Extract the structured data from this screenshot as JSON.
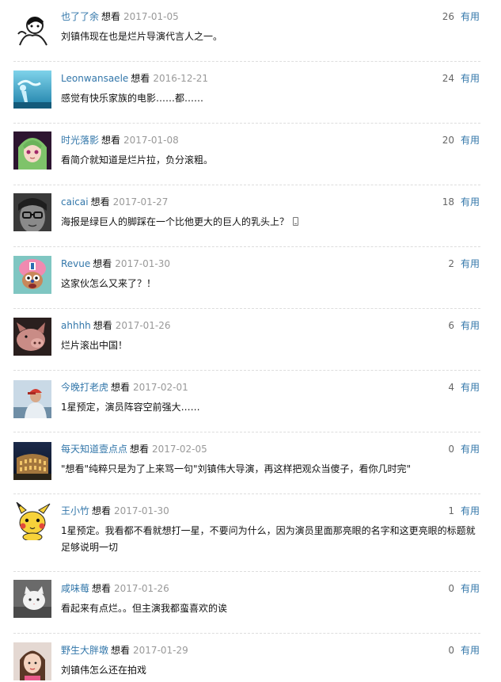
{
  "useful_label": "有用",
  "comments": [
    {
      "user": "也了了余",
      "status": "想看",
      "date": "2017-01-05",
      "votes": "26",
      "text": "刘镇伟现在也是烂片导演代言人之一。",
      "avatar": "bw-sketch-avatar"
    },
    {
      "user": "Leonwansaele",
      "status": "想看",
      "date": "2016-12-21",
      "votes": "24",
      "text": "感觉有快乐家族的电影……都……",
      "avatar": "underwater-blue-avatar"
    },
    {
      "user": "时光落影",
      "status": "想看",
      "date": "2017-01-08",
      "votes": "20",
      "text": "看简介就知道是烂片拉，负分滚粗。",
      "avatar": "anime-girl-avatar"
    },
    {
      "user": "caicai",
      "status": "想看",
      "date": "2017-01-27",
      "votes": "18",
      "text": "海报是绿巨人的脚踩在一个比他更大的巨人的乳头上？",
      "avatar": "glasses-face-avatar",
      "mobile_icon": "mobile-phone-icon"
    },
    {
      "user": "Revue",
      "status": "想看",
      "date": "2017-01-30",
      "votes": "2",
      "text": "这家伙怎么又来了？！",
      "avatar": "cartoon-chopper-avatar"
    },
    {
      "user": "ahhhh",
      "status": "想看",
      "date": "2017-01-26",
      "votes": "6",
      "text": "烂片滚出中国！",
      "avatar": "pig-avatar"
    },
    {
      "user": "今晚打老虎",
      "status": "想看",
      "date": "2017-02-01",
      "votes": "4",
      "text": "1星预定，演员阵容空前强大……",
      "avatar": "red-cap-person-avatar"
    },
    {
      "user": "每天知道壹点点",
      "status": "想看",
      "date": "2017-02-05",
      "votes": "0",
      "text": "\"想看\"纯粹只是为了上来骂一句\"刘镇伟大导演，再这样把观众当傻子，看你几时完\"",
      "avatar": "colosseum-night-avatar"
    },
    {
      "user": "王小竹",
      "status": "想看",
      "date": "2017-01-30",
      "votes": "1",
      "text": "1星预定。我看都不看就想打一星，不要问为什么，因为演员里面那亮眼的名字和这更亮眼的标题就足够说明一切",
      "avatar": "pikachu-avatar"
    },
    {
      "user": "咸味莓",
      "status": "想看",
      "date": "2017-01-26",
      "votes": "0",
      "text": "看起来有点烂。。但主演我都蛮喜欢的诶",
      "avatar": "white-cat-avatar"
    },
    {
      "user": "野生大胖墩",
      "status": "想看",
      "date": "2017-01-29",
      "votes": "0",
      "text": "刘镇伟怎么还在拍戏",
      "avatar": "girl-photo-avatar"
    }
  ]
}
